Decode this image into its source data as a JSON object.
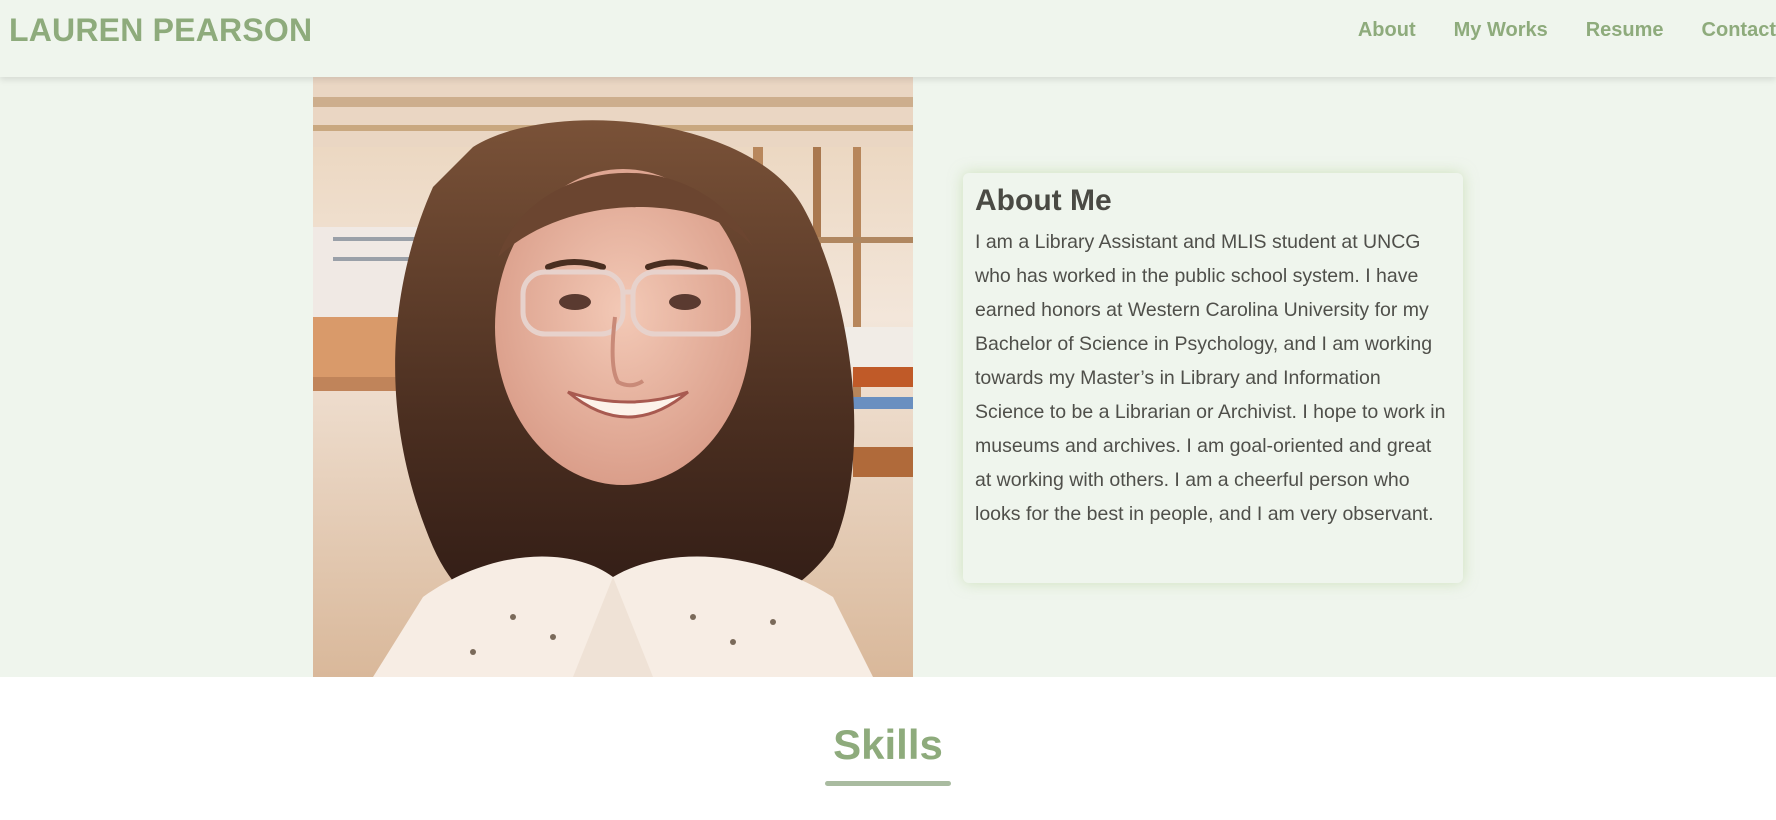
{
  "header": {
    "brand": "LAUREN PEARSON",
    "nav": [
      {
        "label": "About"
      },
      {
        "label": "My Works"
      },
      {
        "label": "Resume"
      },
      {
        "label": "Contact"
      }
    ]
  },
  "about": {
    "title": "About Me",
    "text": "I am a Library Assistant and MLIS student at UNCG who has worked in the public school system. I have earned honors at Western Carolina University for my Bachelor of Science in Psychology, and I am working towards my Master’s in Library and Information Science to be a Librarian or Archivist. I hope to work in museums and archives. I am goal-oriented and great at working with others. I am a cheerful person who looks for the best in people, and I am very observant."
  },
  "skills": {
    "title": "Skills"
  },
  "colors": {
    "accent": "#8eab7c",
    "background": "#eff5ed",
    "text": "#4f4f4a"
  }
}
